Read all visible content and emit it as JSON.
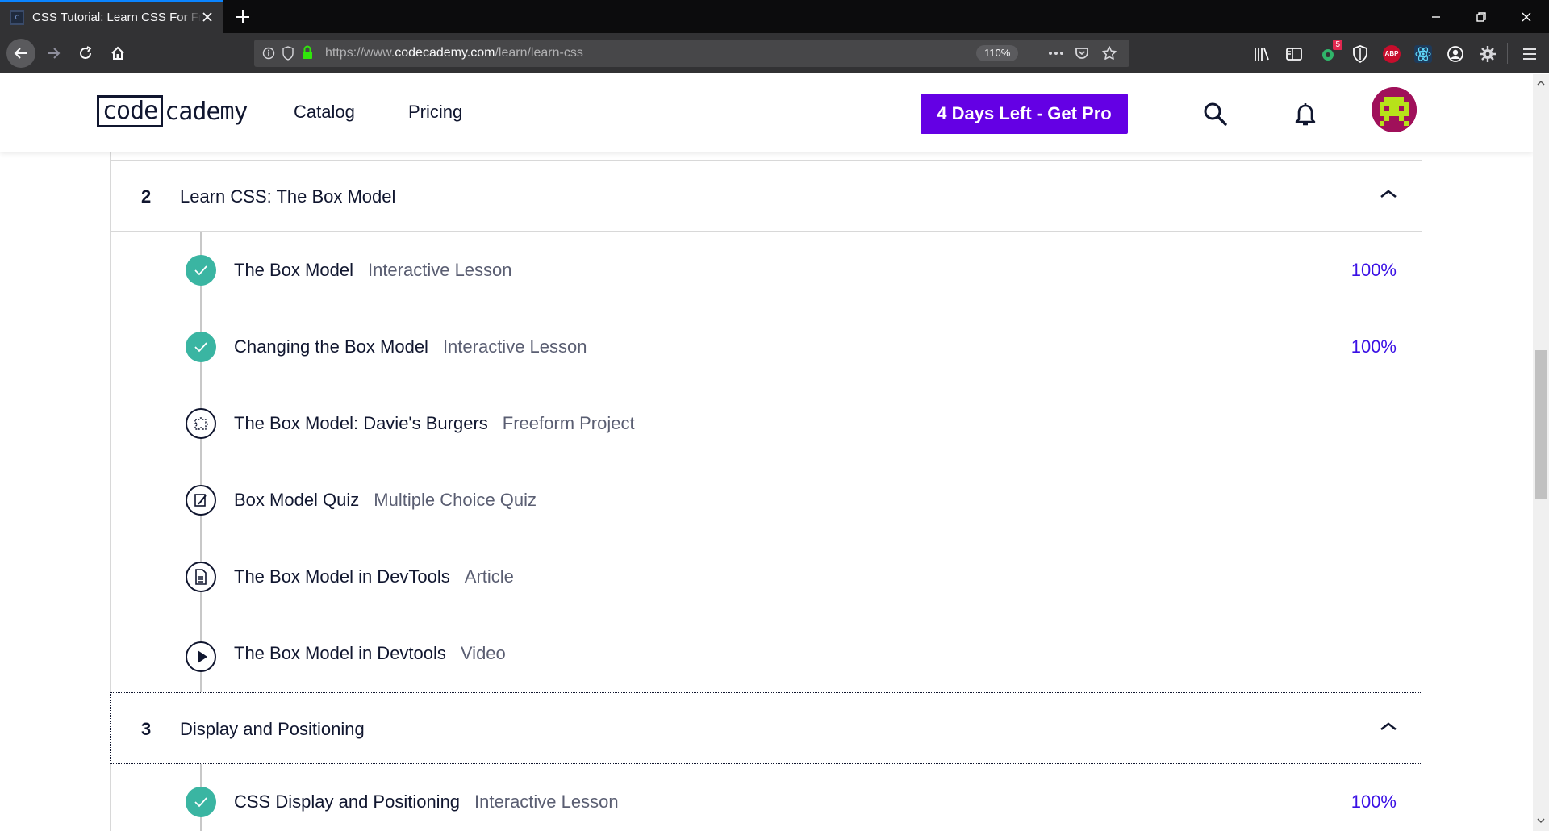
{
  "browser": {
    "tab_title": "CSS Tutorial: Learn CSS For Free",
    "url_prefix": "https://www.",
    "url_host": "codecademy.com",
    "url_path": "/learn/learn-css",
    "zoom": "110%",
    "extension_badge": "5",
    "abp_label": "ABP"
  },
  "header": {
    "logo_boxed": "code",
    "logo_rest": "cademy",
    "nav": [
      "Catalog",
      "Pricing"
    ],
    "pro_button": "4 Days Left - Get Pro"
  },
  "colors": {
    "accent": "#6400e4",
    "complete": "#3ab5a2",
    "percent": "#3a10e5",
    "text": "#10162f"
  },
  "sections": [
    {
      "number": "2",
      "title": "Learn CSS: The Box Model",
      "items": [
        {
          "title": "The Box Model",
          "type": "Interactive Lesson",
          "progress": "100%",
          "icon": "check-icon"
        },
        {
          "title": "Changing the Box Model",
          "type": "Interactive Lesson",
          "progress": "100%",
          "icon": "check-icon"
        },
        {
          "title": "The Box Model: Davie's Burgers",
          "type": "Freeform Project",
          "progress": "",
          "icon": "puzzle-icon"
        },
        {
          "title": "Box Model Quiz",
          "type": "Multiple Choice Quiz",
          "progress": "",
          "icon": "quiz-icon"
        },
        {
          "title": "The Box Model in DevTools",
          "type": "Article",
          "progress": "",
          "icon": "article-icon"
        },
        {
          "title": "The Box Model in Devtools",
          "type": "Video",
          "progress": "",
          "icon": "play-icon"
        }
      ]
    },
    {
      "number": "3",
      "title": "Display and Positioning",
      "items": [
        {
          "title": "CSS Display and Positioning",
          "type": "Interactive Lesson",
          "progress": "100%",
          "icon": "check-icon"
        }
      ]
    }
  ]
}
